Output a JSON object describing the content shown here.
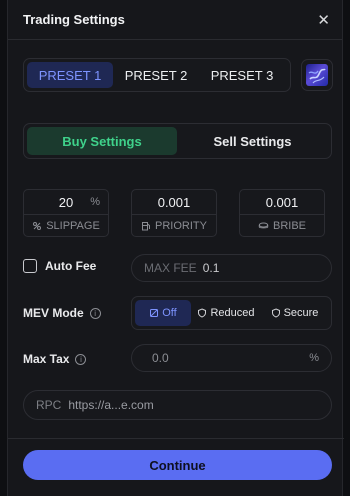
{
  "header": {
    "title": "Trading Settings",
    "close_icon": "close-icon"
  },
  "presets": {
    "items": [
      {
        "label": "PRESET 1",
        "active": true
      },
      {
        "label": "PRESET 2",
        "active": false
      },
      {
        "label": "PRESET 3",
        "active": false
      }
    ],
    "icon": "preset-logo-icon"
  },
  "mode_tabs": {
    "buy": "Buy Settings",
    "sell": "Sell Settings",
    "active": "buy"
  },
  "params": {
    "slippage": {
      "value": "20",
      "unit": "%",
      "label": "SLIPPAGE",
      "icon": "slippage-icon"
    },
    "priority": {
      "value": "0.001",
      "label": "PRIORITY",
      "icon": "gas-pump-icon"
    },
    "bribe": {
      "value": "0.001",
      "label": "BRIBE",
      "icon": "coin-icon"
    }
  },
  "auto_fee": {
    "label": "Auto Fee",
    "checked": false
  },
  "max_fee": {
    "label": "MAX FEE",
    "value": "0.1"
  },
  "mev_mode": {
    "label": "MEV Mode",
    "options": [
      {
        "label": "Off",
        "active": true,
        "icon": "shield-slash-icon"
      },
      {
        "label": "Reduced",
        "active": false,
        "icon": "shield-icon"
      },
      {
        "label": "Secure",
        "active": false,
        "icon": "shield-check-icon"
      }
    ]
  },
  "max_tax": {
    "label": "Max Tax",
    "value": "0.0",
    "unit": "%"
  },
  "rpc": {
    "label": "RPC",
    "value": "https://a...e.com"
  },
  "footer": {
    "continue_label": "Continue"
  },
  "colors": {
    "accent_blue": "#5a6df2",
    "active_preset_text": "#7e94ff",
    "buy_green": "#3fd28b",
    "background": "#16171b"
  }
}
